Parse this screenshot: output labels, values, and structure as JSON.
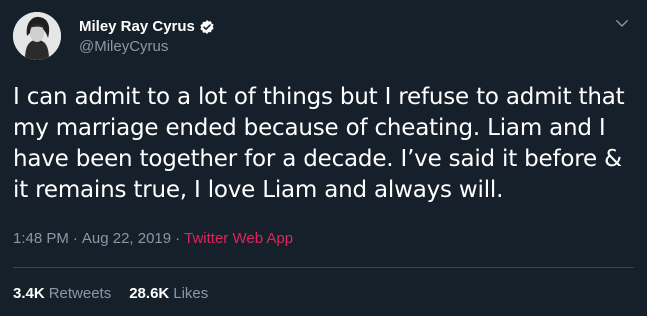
{
  "author": {
    "display_name": "Miley Ray Cyrus",
    "handle": "@MileyCyrus",
    "verified_icon": "verified-badge-icon",
    "avatar": "profile-avatar"
  },
  "tweet": {
    "text": "I can admit to a lot of things but I refuse to admit that my marriage ended because of cheating. Liam and I have been together for a decade. I’ve said it before & it remains true, I love Liam and always will.",
    "time": "1:48 PM",
    "date": "Aug 22, 2019",
    "separator": "·",
    "source": "Twitter Web App"
  },
  "stats": {
    "retweets_count": "3.4K",
    "retweets_label": "Retweets",
    "likes_count": "28.6K",
    "likes_label": "Likes"
  },
  "colors": {
    "background": "#15202b",
    "text_primary": "#ffffff",
    "text_secondary": "#8899a6",
    "source_link": "#e0245e",
    "divider": "#38444d",
    "verified_blue": "#ffffff"
  },
  "icons": {
    "more_menu": "chevron-down-icon"
  }
}
